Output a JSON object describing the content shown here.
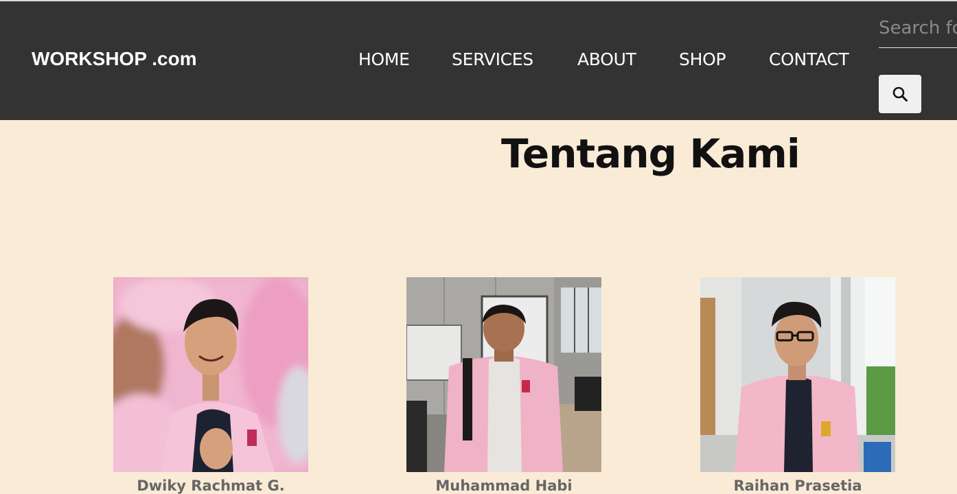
{
  "brand": "WORKSHOP .com",
  "nav": {
    "items": [
      {
        "label": "HOME"
      },
      {
        "label": "SERVICES"
      },
      {
        "label": "ABOUT"
      },
      {
        "label": "SHOP"
      },
      {
        "label": "CONTACT"
      }
    ]
  },
  "search": {
    "placeholder": "Search for...",
    "button_icon": "search-icon"
  },
  "main": {
    "title": "Tentang Kami",
    "members": [
      {
        "name": "Dwiky Rachmat G."
      },
      {
        "name": "Muhammad Habi"
      },
      {
        "name": "Raihan Prasetia"
      }
    ]
  },
  "colors": {
    "navbar_bg": "#333333",
    "page_bg": "#faebd7",
    "nav_text": "#ffffff",
    "title_text": "#111111",
    "name_text": "#666666"
  }
}
